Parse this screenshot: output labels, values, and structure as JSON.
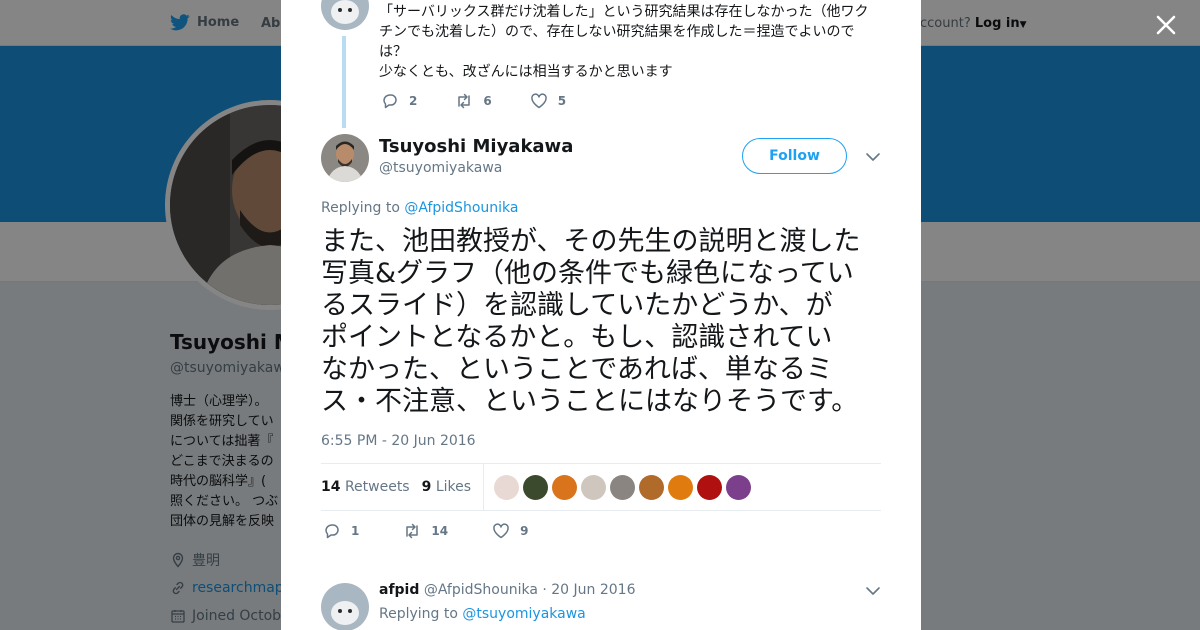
{
  "topnav": {
    "home_label": "Home",
    "about_label": "Abo",
    "account_question": "ccount?",
    "login_label": "Log in"
  },
  "profile": {
    "name": "Tsuyoshi M",
    "handle": "@tsuyomiyakawa",
    "bio_lines": [
      "博士（心理学）。",
      "関係を研究してい",
      "については拙著『",
      "どこまで決まるの",
      "時代の脳科学』(",
      "照ください。 つぶ",
      "団体の見解を反映"
    ],
    "location": "豊明",
    "website": "researchmap.j",
    "joined": "Joined Octobe"
  },
  "prev_tweet": {
    "lines": [
      "「サーバリックス群だけ沈着した」という研究結果は存在しなかった（他ワク",
      "チンでも沈着した）ので、存在しない研究結果を作成した＝捏造でよいので",
      "は？",
      "少なくとも、改ざんには相当するかと思います"
    ],
    "replies": "2",
    "retweets": "6",
    "likes": "5"
  },
  "main_tweet": {
    "name": "Tsuyoshi Miyakawa",
    "handle": "@tsuyomiyakawa",
    "follow_label": "Follow",
    "replying_prefix": "Replying to ",
    "replying_to": "@AfpidShounika",
    "text_lines": [
      "また、池田教授が、その先生の説明と渡した",
      "写真&グラフ（他の条件でも緑色になってい",
      "るスライド）を認識していたかどうか、が",
      "ポイントとなるかと。もし、認識されてい",
      "なかった、ということであれば、単なるミ",
      "ス・不注意、ということにはなりそうです。"
    ],
    "timestamp": "6:55 PM - 20 Jun 2016",
    "retweet_count": "14",
    "retweet_label": "Retweets",
    "like_count": "9",
    "like_label": "Likes",
    "replies": "1",
    "retweets": "14",
    "likes": "9",
    "liker_colors": [
      "#e9d9d4",
      "#3b4a2c",
      "#d9731c",
      "#cfc6bd",
      "#8a8580",
      "#b06a2a",
      "#e07b10",
      "#b0100f",
      "#7b3f8c"
    ]
  },
  "reply_tweet": {
    "name": "afpid",
    "handle": "@AfpidShounika",
    "date": "· 20 Jun 2016",
    "replying_prefix": "Replying to ",
    "replying_to": "@tsuyomiyakawa"
  },
  "colors": {
    "accent": "#1da1f2",
    "banner": "#1b95e0",
    "thread_line": "#b9dcf3"
  }
}
